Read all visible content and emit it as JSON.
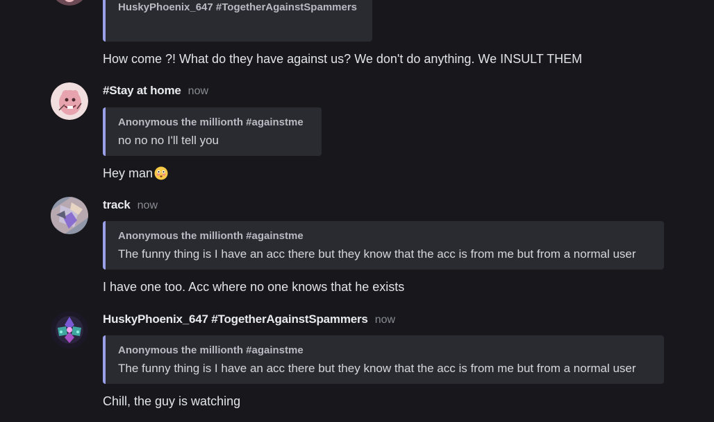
{
  "messages": [
    {
      "avatar": "partial-avatar-icon",
      "quote": {
        "author": "HuskyPhoenix_647 #TogetherAgainstSpammers",
        "text": ""
      },
      "body": "How come ?! What do they have against us? We don't do anything. We INSULT THEM"
    },
    {
      "author": "#Stay at home",
      "timestamp": "now",
      "avatar": "pink-creature-avatar-icon",
      "quote": {
        "author": "Anonymous the millionth #againstme",
        "text": "no no no I'll tell you"
      },
      "body": "Hey man",
      "body_emoji": "flushed-face-emoji-icon"
    },
    {
      "author": "track",
      "timestamp": "now",
      "avatar": "anime-character-avatar-icon",
      "quote": {
        "author": "Anonymous the millionth #againstme",
        "text": "The funny thing is I have an acc there but they know that the acc is from me but from a normal user"
      },
      "body": "I have one too. Acc where no one knows that he exists"
    },
    {
      "author": "HuskyPhoenix_647 #TogetherAgainstSpammers",
      "timestamp": "now",
      "avatar": "crystal-phoenix-avatar-icon",
      "quote": {
        "author": "Anonymous the millionth #againstme",
        "text": "The funny thing is I have an acc there but they know that the acc is from me but from a normal user"
      },
      "body": "Chill, the guy is watching"
    }
  ],
  "colors": {
    "background": "#17171c",
    "quote_background": "#2a2a31",
    "quote_accent": "#9aa0e8",
    "author_text": "#e9eaee",
    "timestamp_text": "#8a8c93"
  }
}
